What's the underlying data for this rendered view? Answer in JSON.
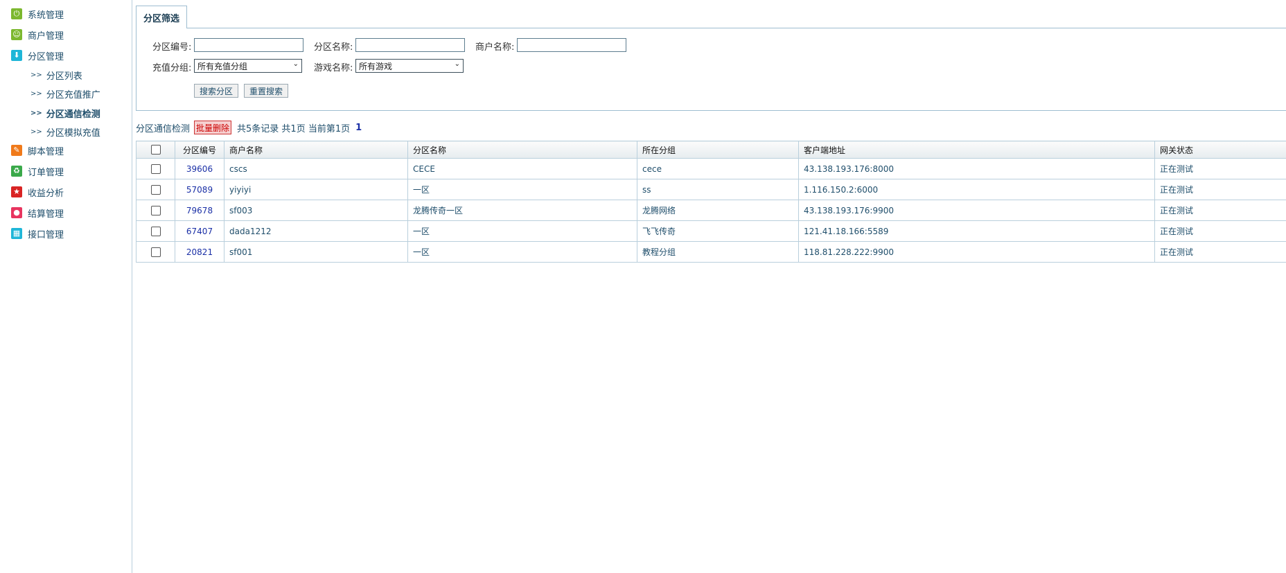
{
  "sidebar": {
    "menu": [
      {
        "label": "系统管理",
        "icon": "power-icon",
        "color": "#7cb82f",
        "glyph": "⏻"
      },
      {
        "label": "商户管理",
        "icon": "smile-icon",
        "color": "#7cb82f",
        "glyph": "☺"
      },
      {
        "label": "分区管理",
        "icon": "download-icon",
        "color": "#1fb6d8",
        "glyph": "⬇"
      },
      {
        "label": "脚本管理",
        "icon": "pencil-icon",
        "color": "#f07a1a",
        "glyph": "✎"
      },
      {
        "label": "订单管理",
        "icon": "recycle-icon",
        "color": "#3aa94a",
        "glyph": "♻"
      },
      {
        "label": "收益分析",
        "icon": "star-icon",
        "color": "#d92424",
        "glyph": "★"
      },
      {
        "label": "结算管理",
        "icon": "record-icon",
        "color": "#e8355f",
        "glyph": "●"
      },
      {
        "label": "接口管理",
        "icon": "grid-icon",
        "color": "#1fb6d8",
        "glyph": "▦"
      }
    ],
    "submenu": [
      {
        "label": "分区列表",
        "arrow": ">>"
      },
      {
        "label": "分区充值推广",
        "arrow": ">>"
      },
      {
        "label": "分区通信检测",
        "arrow": ">>"
      },
      {
        "label": "分区模拟充值",
        "arrow": ">>"
      }
    ]
  },
  "filter": {
    "tab_label": "分区筛选",
    "zone_id_label": "分区编号:",
    "zone_id_value": "",
    "zone_name_label": "分区名称:",
    "zone_name_value": "",
    "merchant_label": "商户名称:",
    "merchant_value": "",
    "group_label": "充值分组:",
    "group_selected": "所有充值分组",
    "game_label": "游戏名称:",
    "game_selected": "所有游戏",
    "search_button": "搜索分区",
    "reset_button": "重置搜索"
  },
  "toolbar": {
    "title": "分区通信检测",
    "batch_delete": "批量删除",
    "info": "共5条记录 共1页 当前第1页",
    "page": "1"
  },
  "table": {
    "headers": [
      "分区编号",
      "商户名称",
      "分区名称",
      "所在分组",
      "客户端地址",
      "网关状态"
    ],
    "rows": [
      {
        "id": "39606",
        "merchant": "cscs",
        "zone": "CECE",
        "group": "cece",
        "addr": "43.138.193.176:8000",
        "status": "正在测试"
      },
      {
        "id": "57089",
        "merchant": "yiyiyi",
        "zone": "一区",
        "group": "ss",
        "addr": "1.116.150.2:6000",
        "status": "正在测试"
      },
      {
        "id": "79678",
        "merchant": "sf003",
        "zone": "龙腾传奇一区",
        "group": "龙腾网络",
        "addr": "43.138.193.176:9900",
        "status": "正在测试"
      },
      {
        "id": "67407",
        "merchant": "dada1212",
        "zone": "一区",
        "group": "飞飞传奇",
        "addr": "121.41.18.166:5589",
        "status": "正在测试"
      },
      {
        "id": "20821",
        "merchant": "sf001",
        "zone": "一区",
        "group": "教程分组",
        "addr": "118.81.228.222:9900",
        "status": "正在测试"
      }
    ]
  }
}
